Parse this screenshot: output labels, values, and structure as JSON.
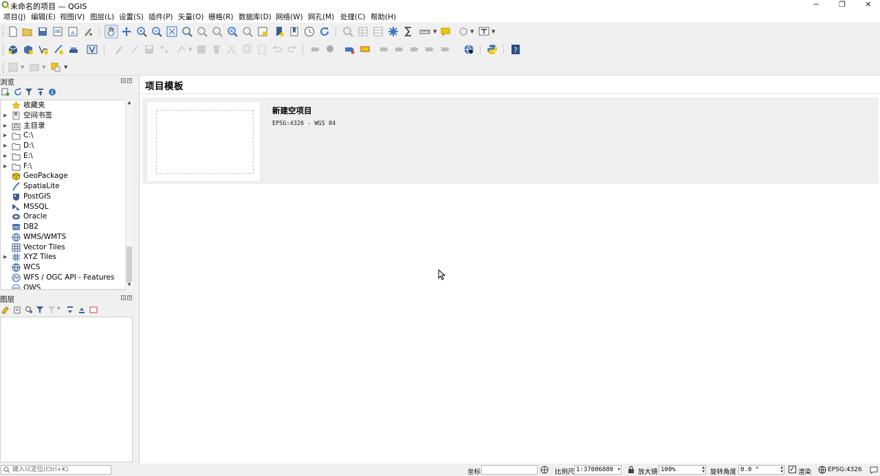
{
  "window": {
    "title": "未命名的项目 — QGIS",
    "minimize_glyph": "─",
    "restore_glyph": "❐",
    "close_glyph": "✕"
  },
  "menubar": {
    "items": [
      "项目(J)",
      "编辑(E)",
      "视图(V)",
      "图层(L)",
      "设置(S)",
      "插件(P)",
      "矢量(O)",
      "栅格(R)",
      "数据库(D)",
      "网络(W)",
      "网孔(M)",
      "处理(C)",
      "帮助(H)"
    ]
  },
  "browser_panel": {
    "title": "浏览",
    "items": [
      {
        "label": "收藏夹",
        "icon": "star-icon",
        "expandable": false
      },
      {
        "label": "空间书签",
        "icon": "bookmark-icon",
        "expandable": true
      },
      {
        "label": "主目录",
        "icon": "home-folder-icon",
        "expandable": true
      },
      {
        "label": "C:\\",
        "icon": "folder-icon",
        "expandable": true
      },
      {
        "label": "D:\\",
        "icon": "folder-icon",
        "expandable": true
      },
      {
        "label": "E:\\",
        "icon": "folder-icon",
        "expandable": true
      },
      {
        "label": "F:\\",
        "icon": "folder-icon",
        "expandable": true
      },
      {
        "label": "GeoPackage",
        "icon": "geopackage-icon",
        "expandable": false
      },
      {
        "label": "SpatiaLite",
        "icon": "spatialite-icon",
        "expandable": false
      },
      {
        "label": "PostGIS",
        "icon": "postgis-icon",
        "expandable": false
      },
      {
        "label": "MSSQL",
        "icon": "mssql-icon",
        "expandable": false
      },
      {
        "label": "Oracle",
        "icon": "oracle-icon",
        "expandable": false
      },
      {
        "label": "DB2",
        "icon": "db2-icon",
        "expandable": false
      },
      {
        "label": "WMS/WMTS",
        "icon": "wms-icon",
        "expandable": false
      },
      {
        "label": "Vector Tiles",
        "icon": "vector-tiles-icon",
        "expandable": false
      },
      {
        "label": "XYZ Tiles",
        "icon": "xyz-tiles-icon",
        "expandable": true
      },
      {
        "label": "WCS",
        "icon": "wcs-icon",
        "expandable": false
      },
      {
        "label": "WFS / OGC API - Features",
        "icon": "wfs-icon",
        "expandable": false
      },
      {
        "label": "OWS",
        "icon": "ows-icon",
        "expandable": false
      }
    ]
  },
  "layers_panel": {
    "title": "图层"
  },
  "main": {
    "title": "项目模板",
    "template": {
      "name": "新建空项目",
      "crs": "EPSG:4326 - WGS 84"
    }
  },
  "statusbar": {
    "locator_placeholder": "键入以定位(Ctrl+K)",
    "coordinate_label": "坐标",
    "coordinate_value": "",
    "scale_label": "比例尺",
    "scale_value": "1:37006880",
    "magnifier_label": "放大镜",
    "magnifier_value": "100%",
    "rotation_label": "旋转角度",
    "rotation_value": "0.0 °",
    "render_label": "渲染",
    "crs_value": "EPSG:4326"
  },
  "colors": {
    "qgis_green": "#589632",
    "qgis_yellow": "#eec900",
    "folder": "#e8c35a",
    "accent_blue": "#3b73c4"
  }
}
